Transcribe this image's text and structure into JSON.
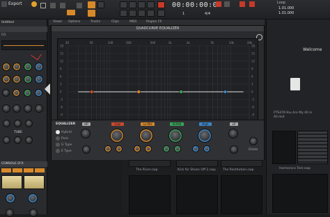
{
  "topbar": {
    "menu": {
      "left": "Export"
    },
    "mode_items": [
      "Screen",
      "Select",
      "Move",
      "Cut",
      "Erase",
      "Smart"
    ],
    "timecode": "00:00:00:00",
    "bars": "1",
    "beat": "4/4",
    "loop_label": "Loop",
    "loop_values": [
      "1.01.000",
      "1.01.000"
    ],
    "right_labels": [
      "Screen",
      "Cut",
      "Snap",
      "Inst"
    ]
  },
  "left_panel": {
    "title": "Untitled",
    "section_label": "EQ",
    "sends_label": "CONSOLE EFX",
    "bottom_label": "TUBE"
  },
  "main_menu": [
    "Views",
    "Options",
    "Tracks",
    "Clips",
    "MIDI",
    "Region FX"
  ],
  "eq": {
    "title": "QUADCURVE EQUALIZER",
    "freq_labels": [
      "20",
      "50",
      "100",
      "200",
      "500",
      "1k",
      "2k",
      "5k",
      "10k",
      "20k"
    ],
    "db_labels": [
      "18",
      "15",
      "12",
      "9",
      "6",
      "3",
      "0",
      "-3",
      "-6",
      "-9",
      "-12",
      "-15",
      "-18"
    ],
    "bands": [
      {
        "name": "Low",
        "color": "#c84a2e",
        "knobs": [
          "Gain",
          "Freq",
          "Q"
        ],
        "values": [
          "0.0",
          "50",
          "0.7"
        ]
      },
      {
        "name": "Lo-Mid",
        "color": "#d8892a",
        "knobs": [
          "Gain",
          "Freq",
          "Q"
        ],
        "values": [
          "0.0",
          "300",
          "0.7"
        ]
      },
      {
        "name": "Hi-Mid",
        "color": "#3aa35a",
        "knobs": [
          "Gain",
          "Freq",
          "Q"
        ],
        "values": [
          "0.0",
          "1.5k",
          "0.7"
        ]
      },
      {
        "name": "High",
        "color": "#3c86c6",
        "knobs": [
          "Gain",
          "Freq",
          "Q"
        ],
        "values": [
          "0.0",
          "8k",
          "0.7"
        ]
      }
    ],
    "left_label": "EQUALIZER",
    "mode_options": [
      "Hybrid",
      "Pure",
      "G Type",
      "E Type"
    ],
    "hp_label": "HP",
    "lp_label": "LP",
    "output_label": "Gain",
    "dilate_label": "Dilate"
  },
  "right_panel": {
    "header": "Welcome",
    "file1": "PTS476-You Are My All in All.mid",
    "file2": "",
    "file3": "Harmonics Test.cwp"
  },
  "tracks": {
    "names": [
      "The River.cwp",
      "Kick for Shoes Off 2.cwp",
      "The Restitution.cwp"
    ]
  },
  "colors": {
    "accent_orange": "#d8892a",
    "accent_red": "#c63a2a",
    "band_low": "#c84a2e",
    "band_lomid": "#d8892a",
    "band_himid": "#3aa35a",
    "band_high": "#3c86c6"
  }
}
